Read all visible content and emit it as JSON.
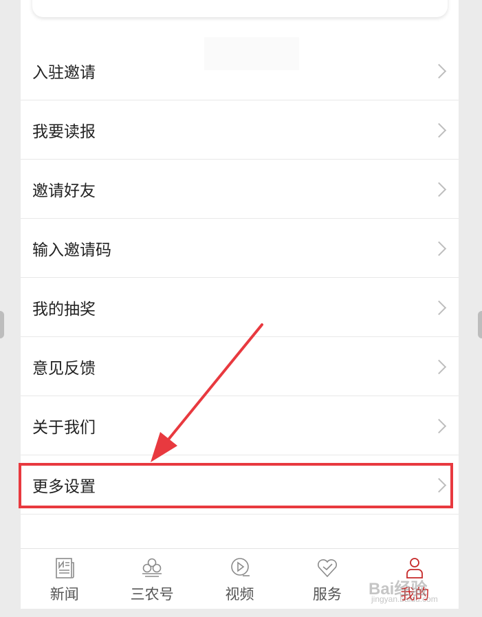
{
  "menu": {
    "items": [
      {
        "label": "入驻邀请"
      },
      {
        "label": "我要读报"
      },
      {
        "label": "邀请好友"
      },
      {
        "label": "输入邀请码"
      },
      {
        "label": "我的抽奖"
      },
      {
        "label": "意见反馈"
      },
      {
        "label": "关于我们"
      },
      {
        "label": "更多设置"
      }
    ]
  },
  "tabbar": {
    "tabs": [
      {
        "label": "新闻",
        "icon": "newspaper-icon"
      },
      {
        "label": "三农号",
        "icon": "clover-icon"
      },
      {
        "label": "视频",
        "icon": "play-icon"
      },
      {
        "label": "服务",
        "icon": "heart-icon"
      },
      {
        "label": "我的",
        "icon": "person-icon",
        "active": true
      }
    ]
  },
  "annotation": {
    "color": "#e8393f"
  },
  "watermark": {
    "text": "Bai经验",
    "sub": "jingyan.baidu.com"
  },
  "colors": {
    "active_tab": "#c62828",
    "background": "#ffffff"
  }
}
